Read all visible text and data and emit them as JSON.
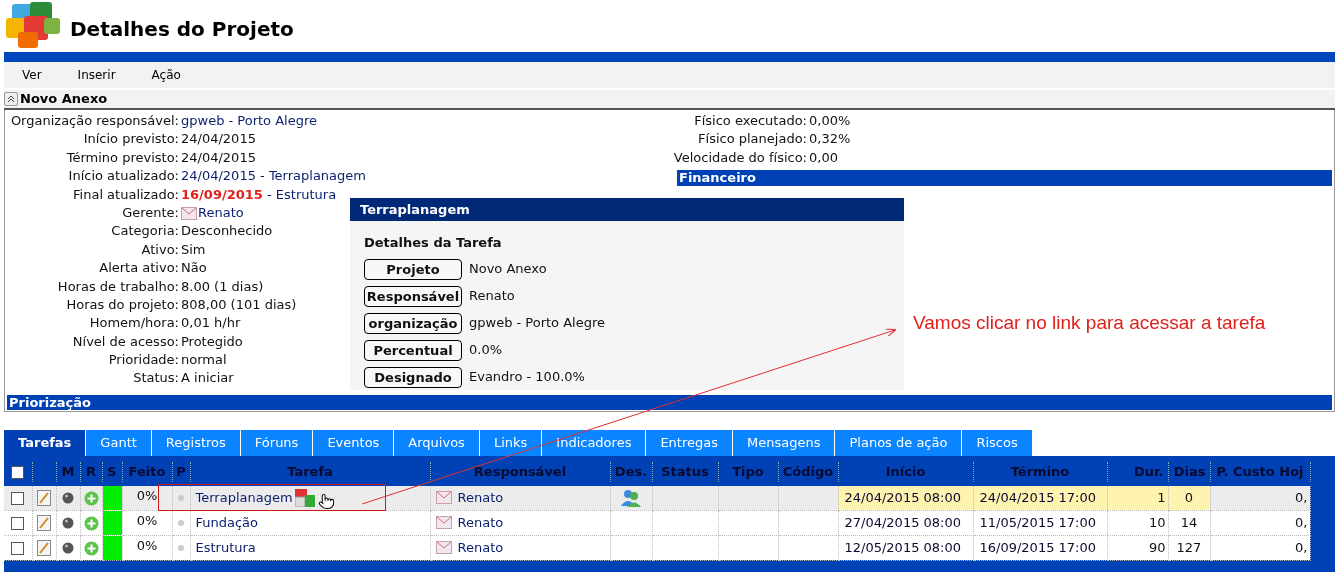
{
  "header": {
    "title": "Detalhes do Projeto"
  },
  "menu": [
    {
      "label": "Ver"
    },
    {
      "label": "Inserir"
    },
    {
      "label": "Ação"
    }
  ],
  "section": {
    "title": "Novo Anexo",
    "expanded": true
  },
  "details_left": [
    {
      "label": "Organização responsável:",
      "value": "gpweb - Porto Alegre",
      "kind": "link"
    },
    {
      "label": "Início previsto:",
      "value": "24/04/2015",
      "kind": "text"
    },
    {
      "label": "Término previsto:",
      "value": "24/04/2015",
      "kind": "text"
    },
    {
      "label": "Início atualizado:",
      "value": "24/04/2015 - Terraplanagem",
      "kind": "link"
    },
    {
      "label": "Final atualizado:",
      "value": "16/09/2015",
      "suffix": " - Estrutura",
      "kind": "late"
    },
    {
      "label": "Gerente:",
      "value": "Renato",
      "kind": "user"
    },
    {
      "label": "Categoria:",
      "value": "Desconhecido",
      "kind": "text"
    },
    {
      "label": "Ativo:",
      "value": "Sim",
      "kind": "text"
    },
    {
      "label": "Alerta ativo:",
      "value": "Não",
      "kind": "text"
    },
    {
      "label": "Horas de trabalho:",
      "value": "8.00 (1 dias)",
      "kind": "text"
    },
    {
      "label": "Horas do projeto:",
      "value": "808,00 (101 dias)",
      "kind": "text"
    },
    {
      "label": "Homem/hora:",
      "value": "0,01 h/hr",
      "kind": "text"
    },
    {
      "label": "Nível de acesso:",
      "value": "Protegido",
      "kind": "text"
    },
    {
      "label": "Prioridade:",
      "value": "normal",
      "kind": "text"
    },
    {
      "label": "Status:",
      "value": "A iniciar",
      "kind": "text"
    }
  ],
  "details_right": [
    {
      "label": "Físico executado:",
      "value": "0,00%"
    },
    {
      "label": "Físico planejado:",
      "value": "0,32%"
    },
    {
      "label": "Velocidade do físico:",
      "value": "0,00"
    }
  ],
  "financeiro": {
    "title": "Financeiro"
  },
  "priorizacao": {
    "title": "Priorização"
  },
  "tabs": [
    {
      "label": "Tarefas",
      "selected": true
    },
    {
      "label": "Gantt",
      "selected": false
    },
    {
      "label": "Registros",
      "selected": false
    },
    {
      "label": "Fóruns",
      "selected": false
    },
    {
      "label": "Eventos",
      "selected": false
    },
    {
      "label": "Arquivos",
      "selected": false
    },
    {
      "label": "Links",
      "selected": false
    },
    {
      "label": "Indicadores",
      "selected": false
    },
    {
      "label": "Entregas",
      "selected": false
    },
    {
      "label": "Mensagens",
      "selected": false
    },
    {
      "label": "Planos de ação",
      "selected": false
    },
    {
      "label": "Riscos",
      "selected": false
    }
  ],
  "table": {
    "select_all": {
      "checked": false
    },
    "columns": [
      "M",
      "R",
      "S",
      "Feito",
      "P",
      "Tarefa",
      "Responsável",
      "Des.",
      "Status",
      "Tipo",
      "Código",
      "Início",
      "Término",
      "Dur.",
      "Dias",
      "P. Custo Hoj"
    ],
    "rows": [
      {
        "selected": true,
        "checked": false,
        "color": "#00ee00",
        "feito": "0%",
        "tarefa": "Terraplanagem",
        "cost_icon": true,
        "responsavel": "Renato",
        "designees": true,
        "inicio": "24/04/2015 08:00",
        "termino": "24/04/2015 17:00",
        "dur": "1",
        "dias": "0",
        "custo": "0,"
      },
      {
        "selected": false,
        "checked": false,
        "color": "#00ee00",
        "feito": "0%",
        "tarefa": "Fundação",
        "cost_icon": false,
        "responsavel": "Renato",
        "designees": false,
        "inicio": "27/04/2015 08:00",
        "termino": "11/05/2015 17:00",
        "dur": "10",
        "dias": "14",
        "custo": "0,"
      },
      {
        "selected": false,
        "checked": false,
        "color": "#00ee00",
        "feito": "0%",
        "tarefa": "Estrutura",
        "cost_icon": false,
        "responsavel": "Renato",
        "designees": false,
        "inicio": "12/05/2015 08:00",
        "termino": "16/09/2015 17:00",
        "dur": "90",
        "dias": "127",
        "custo": "0,"
      }
    ]
  },
  "popup": {
    "title": "Terraplanagem",
    "subtitle": "Detalhes da Tarefa",
    "fields": [
      {
        "label": "Projeto",
        "value": "Novo Anexo"
      },
      {
        "label": "Responsável",
        "value": "Renato"
      },
      {
        "label": "organização",
        "value": "gpweb - Porto Alegre"
      },
      {
        "label": "Percentual",
        "value": "0.0%"
      },
      {
        "label": "Designado",
        "value": "Evandro - 100.0%"
      }
    ]
  },
  "annotation": {
    "text": "Vamos clicar no link para acessar a tarefa"
  }
}
